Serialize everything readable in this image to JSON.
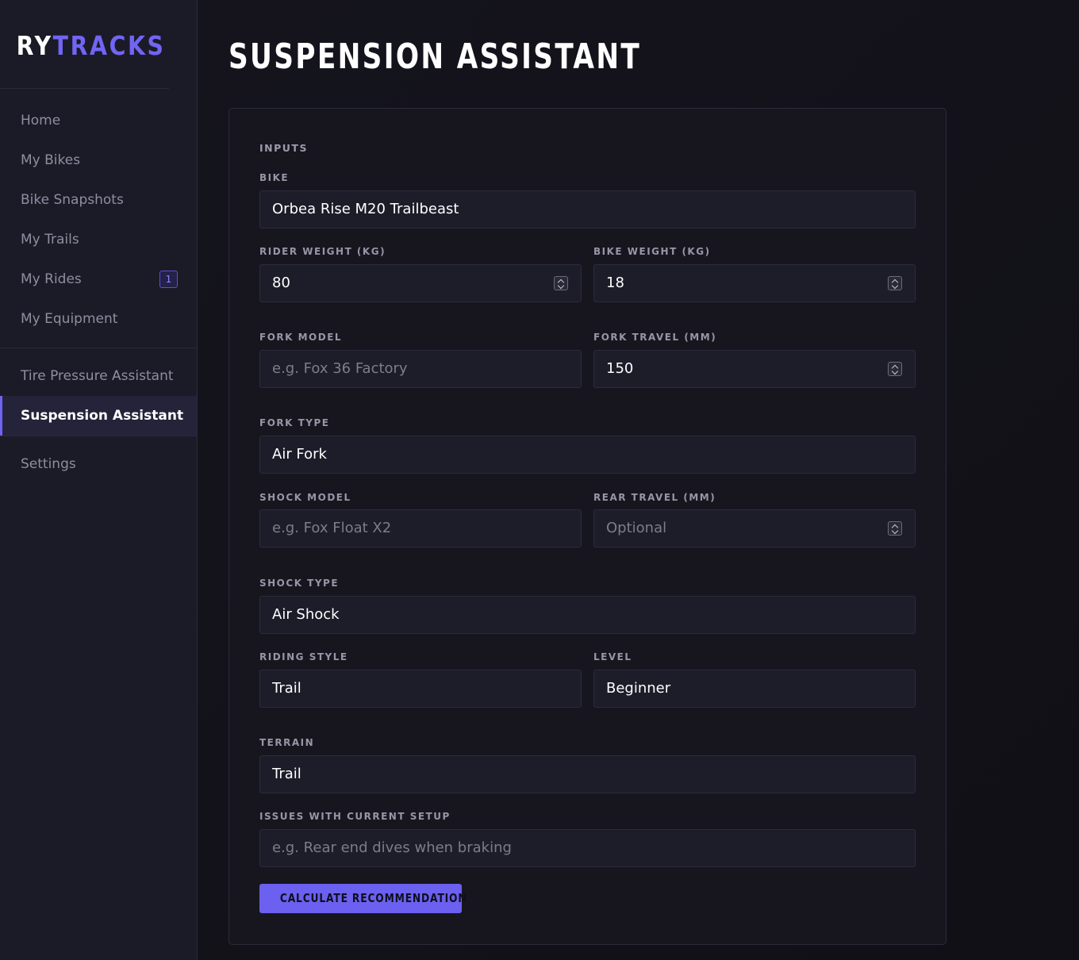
{
  "brand": {
    "part1": "RY",
    "part2": "TRACKS"
  },
  "sidebar": {
    "group1": [
      {
        "label": "Home"
      },
      {
        "label": "My Bikes"
      },
      {
        "label": "Bike Snapshots"
      },
      {
        "label": "My Trails"
      },
      {
        "label": "My Rides",
        "badge": "1"
      },
      {
        "label": "My Equipment"
      }
    ],
    "group2": [
      {
        "label": "Tire Pressure Assistant"
      },
      {
        "label": "Suspension Assistant",
        "active": true
      }
    ],
    "group3": [
      {
        "label": "Settings"
      }
    ]
  },
  "page": {
    "title": "SUSPENSION ASSISTANT"
  },
  "form": {
    "section_label": "INPUTS",
    "bike": {
      "label": "BIKE",
      "value": "Orbea Rise M20 Trailbeast"
    },
    "rider_weight": {
      "label": "RIDER WEIGHT (KG)",
      "value": "80"
    },
    "bike_weight": {
      "label": "BIKE WEIGHT (KG)",
      "value": "18"
    },
    "fork_model": {
      "label": "FORK MODEL",
      "placeholder": "e.g. Fox 36 Factory"
    },
    "fork_travel": {
      "label": "FORK TRAVEL (MM)",
      "value": "150"
    },
    "fork_type": {
      "label": "FORK TYPE",
      "value": "Air Fork"
    },
    "shock_model": {
      "label": "SHOCK MODEL",
      "placeholder": "e.g. Fox Float X2"
    },
    "rear_travel": {
      "label": "REAR TRAVEL (MM)",
      "placeholder": "Optional"
    },
    "shock_type": {
      "label": "SHOCK TYPE",
      "value": "Air Shock"
    },
    "riding_style": {
      "label": "RIDING STYLE",
      "value": "Trail"
    },
    "level": {
      "label": "LEVEL",
      "value": "Beginner"
    },
    "terrain": {
      "label": "TERRAIN",
      "value": "Trail"
    },
    "issues": {
      "label": "ISSUES WITH CURRENT SETUP",
      "placeholder": "e.g. Rear end dives when braking"
    },
    "submit_label": "CALCULATE RECOMMENDATION"
  }
}
